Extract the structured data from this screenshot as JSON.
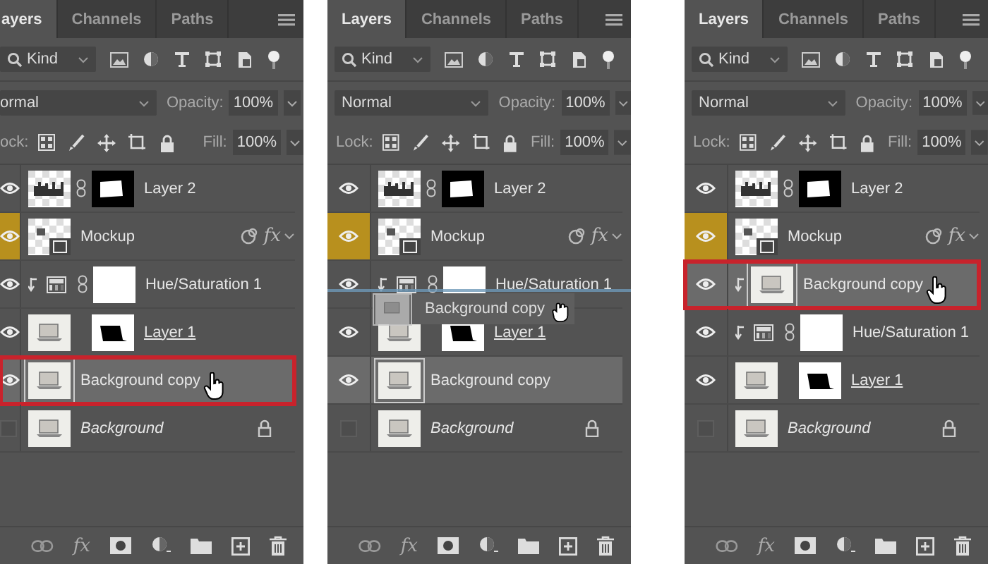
{
  "panels": [
    {
      "tabs": [
        {
          "label": "ayers",
          "selected": true
        },
        {
          "label": "Channels",
          "selected": false
        },
        {
          "label": "Paths",
          "selected": false
        }
      ],
      "filter": "Kind",
      "blend": "ormal",
      "opacity_label": "Opacity:",
      "opacity": "100%",
      "lock_label": "ock:",
      "fill_label": "Fill:",
      "fill": "100%",
      "fx": "fx",
      "layers": [
        {
          "name": "Layer 2",
          "kind": "linked",
          "visible": true,
          "selected": false,
          "outlined": false,
          "clipped": false,
          "eye_highlight": false,
          "underlined": false,
          "cursor": false
        },
        {
          "name": "Mockup",
          "kind": "smart",
          "effects": "fx",
          "visible": true,
          "selected": false,
          "outlined": false,
          "clipped": false,
          "eye_highlight": true,
          "underlined": false,
          "cursor": false
        },
        {
          "name": "Hue/Saturation 1",
          "kind": "adjustment",
          "visible": true,
          "selected": false,
          "outlined": false,
          "clipped": true,
          "eye_highlight": false,
          "underlined": false,
          "cursor": false
        },
        {
          "name": "Layer 1",
          "kind": "masked",
          "visible": true,
          "selected": false,
          "outlined": false,
          "clipped": false,
          "eye_highlight": false,
          "underlined": true,
          "cursor": false
        },
        {
          "name": "Background copy",
          "kind": "pixel",
          "visible": true,
          "selected": true,
          "outlined": true,
          "clipped": false,
          "eye_highlight": false,
          "underlined": false,
          "cursor": true
        },
        {
          "name": "Background",
          "kind": "background",
          "visible": false,
          "selected": false,
          "outlined": false,
          "clipped": false,
          "eye_highlight": false,
          "underlined": false,
          "cursor": false
        }
      ]
    },
    {
      "tabs": [
        {
          "label": "Layers",
          "selected": true
        },
        {
          "label": "Channels",
          "selected": false
        },
        {
          "label": "Paths",
          "selected": false
        }
      ],
      "filter": "Kind",
      "blend": "Normal",
      "opacity_label": "Opacity:",
      "opacity": "100%",
      "lock_label": "Lock:",
      "fill_label": "Fill:",
      "fill": "100%",
      "fx": "fx",
      "drag_ghost": {
        "name": "Background copy"
      },
      "layers": [
        {
          "name": "Layer 2",
          "kind": "linked",
          "visible": true,
          "selected": false,
          "outlined": false,
          "clipped": false,
          "eye_highlight": false,
          "underlined": false,
          "cursor": false
        },
        {
          "name": "Mockup",
          "kind": "smart",
          "effects": "fx",
          "visible": true,
          "selected": false,
          "outlined": false,
          "clipped": false,
          "eye_highlight": true,
          "underlined": false,
          "cursor": false
        },
        {
          "name": "Hue/Saturation 1",
          "kind": "adjustment",
          "visible": true,
          "selected": false,
          "outlined": false,
          "clipped": true,
          "eye_highlight": false,
          "underlined": false,
          "cursor": false
        },
        {
          "name": "Layer 1",
          "kind": "masked",
          "visible": true,
          "selected": false,
          "outlined": false,
          "clipped": false,
          "eye_highlight": false,
          "underlined": true,
          "cursor": false
        },
        {
          "name": "Background copy",
          "kind": "pixel",
          "visible": true,
          "selected": true,
          "outlined": false,
          "clipped": false,
          "eye_highlight": false,
          "underlined": false,
          "cursor": false
        },
        {
          "name": "Background",
          "kind": "background",
          "visible": false,
          "selected": false,
          "outlined": false,
          "clipped": false,
          "eye_highlight": false,
          "underlined": false,
          "cursor": false
        }
      ]
    },
    {
      "tabs": [
        {
          "label": "Layers",
          "selected": true
        },
        {
          "label": "Channels",
          "selected": false
        },
        {
          "label": "Paths",
          "selected": false
        }
      ],
      "filter": "Kind",
      "blend": "Normal",
      "opacity_label": "Opacity:",
      "opacity": "100%",
      "lock_label": "Lock:",
      "fill_label": "Fill:",
      "fill": "100%",
      "fx": "fx",
      "layers": [
        {
          "name": "Layer 2",
          "kind": "linked",
          "visible": true,
          "selected": false,
          "outlined": false,
          "clipped": false,
          "eye_highlight": false,
          "underlined": false,
          "cursor": false
        },
        {
          "name": "Mockup",
          "kind": "smart",
          "effects": "fx",
          "visible": true,
          "selected": false,
          "outlined": false,
          "clipped": false,
          "eye_highlight": true,
          "underlined": false,
          "cursor": false
        },
        {
          "name": "Background copy",
          "kind": "pixel",
          "visible": true,
          "selected": true,
          "outlined": true,
          "clipped": true,
          "eye_highlight": false,
          "underlined": false,
          "cursor": true
        },
        {
          "name": "Hue/Saturation 1",
          "kind": "adjustment",
          "visible": true,
          "selected": false,
          "outlined": false,
          "clipped": true,
          "eye_highlight": false,
          "underlined": false,
          "cursor": false
        },
        {
          "name": "Layer 1",
          "kind": "masked",
          "visible": true,
          "selected": false,
          "outlined": false,
          "clipped": false,
          "eye_highlight": false,
          "underlined": true,
          "cursor": false
        },
        {
          "name": "Background",
          "kind": "background",
          "visible": false,
          "selected": false,
          "outlined": false,
          "clipped": false,
          "eye_highlight": false,
          "underlined": false,
          "cursor": false
        }
      ]
    }
  ]
}
